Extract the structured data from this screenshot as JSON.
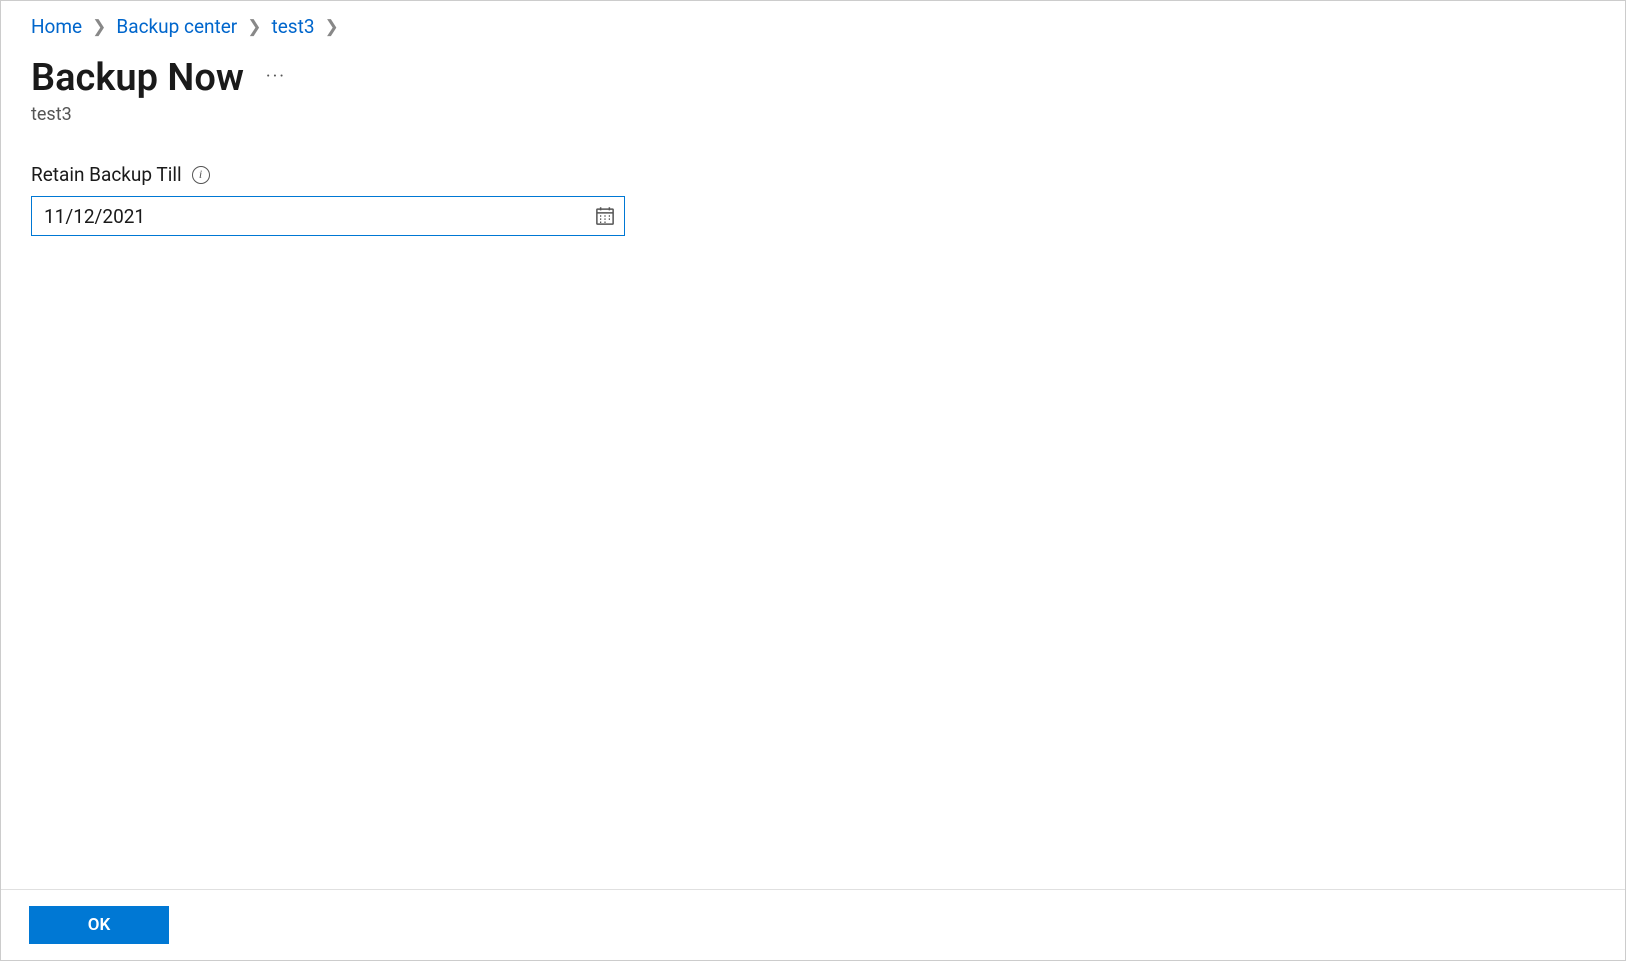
{
  "breadcrumb": {
    "items": [
      "Home",
      "Backup center",
      "test3"
    ]
  },
  "header": {
    "title": "Backup Now",
    "subtitle": "test3",
    "more": "···"
  },
  "form": {
    "retain_label": "Retain Backup Till",
    "date_value": "11/12/2021"
  },
  "footer": {
    "ok_label": "OK"
  }
}
